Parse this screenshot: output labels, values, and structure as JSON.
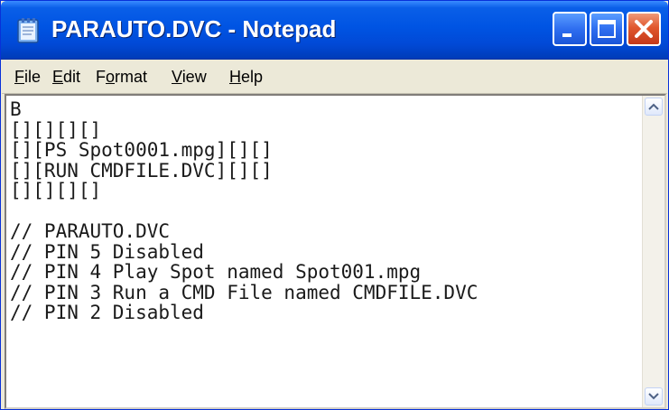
{
  "window": {
    "title": "PARAUTO.DVC - Notepad",
    "icon": "notepad-icon",
    "controls": {
      "minimize": "minimize-icon",
      "maximize": "maximize-icon",
      "close": "close-icon"
    }
  },
  "menu": {
    "items": [
      {
        "label_pre": "",
        "label_u": "F",
        "label_post": "ile"
      },
      {
        "label_pre": "",
        "label_u": "E",
        "label_post": "dit"
      },
      {
        "label_pre": "F",
        "label_u": "o",
        "label_post": "rmat"
      },
      {
        "label_pre": "",
        "label_u": "V",
        "label_post": "iew"
      },
      {
        "label_pre": "",
        "label_u": "H",
        "label_post": "elp"
      }
    ]
  },
  "editor": {
    "text": "B\n[][][][]\n[][PS Spot0001.mpg][][]\n[][RUN CMDFILE.DVC][][]\n[][][][]\n\n// PARAUTO.DVC\n// PIN 5 Disabled\n// PIN 4 Play Spot named Spot001.mpg\n// PIN 3 Run a CMD File named CMDFILE.DVC\n// PIN 2 Disabled"
  },
  "colors": {
    "titlebar": "#0054e3",
    "close_button": "#e1582e",
    "menubar": "#ece9d8"
  }
}
